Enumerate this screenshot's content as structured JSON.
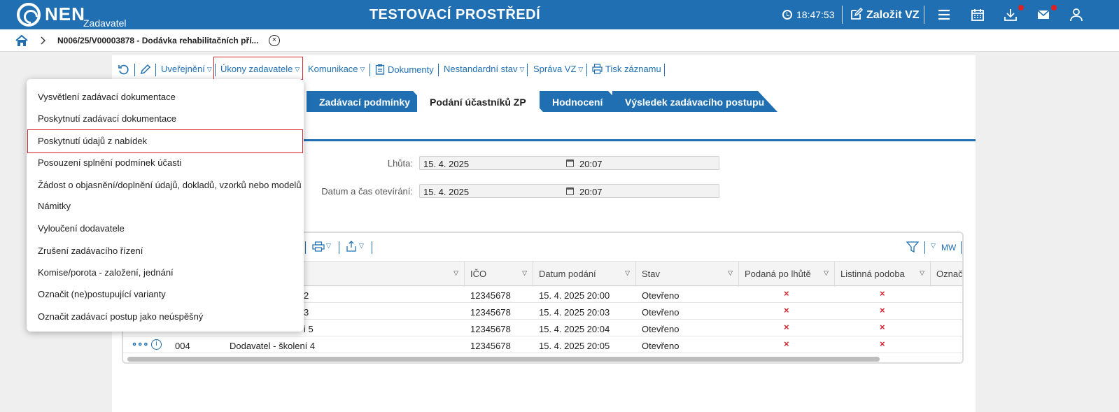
{
  "header": {
    "logo_text": "NEN",
    "logo_sub": "Zadavatel",
    "env_title": "TESTOVACÍ PROSTŘEDÍ",
    "clock": "18:47:53",
    "create_vz": "Založit VZ"
  },
  "breadcrumb": {
    "text": "N006/25/V00003878 - Dodávka rehabilitačních pří..."
  },
  "toolbar": {
    "publish": "Uveřejnění",
    "actions": "Úkony zadavatele",
    "communication": "Komunikace",
    "documents": "Dokumenty",
    "nonstandard": "Nestandardní stav",
    "manage": "Správa VZ",
    "print": "Tisk záznamu"
  },
  "tabs": [
    {
      "label": "Zadávací podmínky"
    },
    {
      "label": "Podání účastníků ZP"
    },
    {
      "label": "Hodnocení"
    },
    {
      "label": "Výsledek zadávacího postupu"
    }
  ],
  "form": {
    "deadline_label": "Lhůta:",
    "deadline_date": "15. 4. 2025",
    "deadline_time": "20:07",
    "opening_label": "Datum a čas otevírání:",
    "opening_date": "15. 4. 2025",
    "opening_time": "20:07"
  },
  "grid": {
    "mw_label": "MW",
    "columns": [
      "IČO",
      "Datum podání",
      "Stav",
      "Podaná po lhůtě",
      "Listinná podoba",
      "Označe"
    ],
    "rows": [
      {
        "num": "",
        "name": "2",
        "ico": "12345678",
        "date": "15. 4. 2025 20:00",
        "status": "Otevřeno"
      },
      {
        "num": "",
        "name": "3",
        "ico": "12345678",
        "date": "15. 4. 2025 20:03",
        "status": "Otevřeno"
      },
      {
        "num": "",
        "name": "i 5",
        "ico": "12345678",
        "date": "15. 4. 2025 20:04",
        "status": "Otevřeno"
      },
      {
        "num": "004",
        "name": "Dodavatel - školení 4",
        "ico": "12345678",
        "date": "15. 4. 2025 20:05",
        "status": "Otevřeno"
      }
    ],
    "mark": "×"
  },
  "menu": {
    "items": [
      "Vysvětlení zadávací dokumentace",
      "Poskytnutí zadávací dokumentace",
      "Poskytnutí údajů z nabídek",
      "Posouzení splnění podmínek účasti",
      "Žádost o objasnění/doplnění údajů, dokladů, vzorků nebo modelů",
      "Námitky",
      "Vyloučení dodavatele",
      "Zrušení zadávacího řízení",
      "Komise/porota - založení, jednání",
      "Označit (ne)postupující varianty",
      "Označit zadávací postup jako neúspěšný"
    ]
  },
  "colors": {
    "brand": "#1f6fb2",
    "highlight": "#d9232d",
    "notification": "#e02020"
  }
}
